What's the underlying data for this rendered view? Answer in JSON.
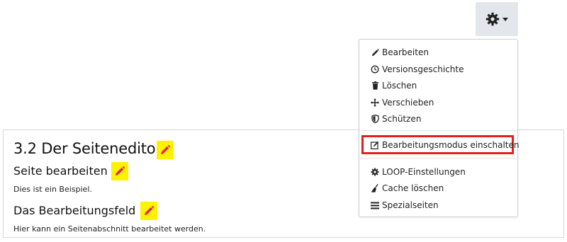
{
  "toolbar": {
    "settings_icon": "gear-icon",
    "caret_icon": "caret-down-icon"
  },
  "page": {
    "title": "3.2 Der Seiteneditor",
    "section1_heading": "Seite bearbeiten",
    "section1_text": "Dies ist ein Beispiel.",
    "section2_heading": "Das Bearbeitungsfeld",
    "section2_text": "Hier kann ein Seitenabschnitt bearbeitet werden.",
    "edit_icon": "pencil-icon",
    "highlight_color": "#fff200",
    "pencil_color": "#e0254a"
  },
  "menu": {
    "items": [
      {
        "label": "Bearbeiten",
        "icon": "pencil-icon"
      },
      {
        "label": "Versionsgeschichte",
        "icon": "history-icon"
      },
      {
        "label": "Löschen",
        "icon": "trash-icon"
      },
      {
        "label": "Verschieben",
        "icon": "move-icon"
      },
      {
        "label": "Schützen",
        "icon": "shield-icon"
      },
      {
        "label": "Bearbeitungsmodus einschalten",
        "icon": "edit-square-icon"
      },
      {
        "label": "LOOP-Einstellungen",
        "icon": "gear-icon"
      },
      {
        "label": "Cache löschen",
        "icon": "broom-icon"
      },
      {
        "label": "Spezialseiten",
        "icon": "bars-icon"
      }
    ],
    "highlight_border_color": "#e0201e"
  }
}
